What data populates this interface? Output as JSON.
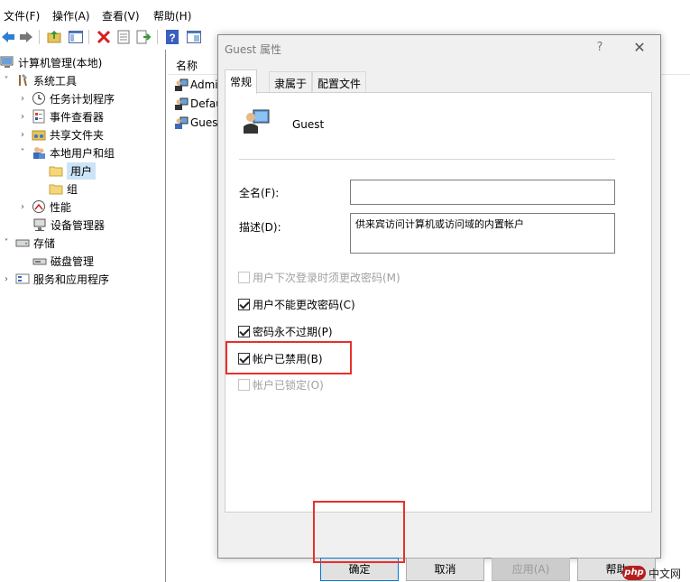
{
  "menu": {
    "items": [
      {
        "label": "文件(F)"
      },
      {
        "label": "操作(A)"
      },
      {
        "label": "查看(V)"
      },
      {
        "label": "帮助(H)"
      }
    ]
  },
  "toolbar": {
    "icons": [
      "back-arrow-icon",
      "forward-arrow-icon",
      "up-folder-icon",
      "show-hide-tree-icon",
      "delete-icon",
      "properties-icon",
      "export-icon",
      "help-icon",
      "console-icon"
    ]
  },
  "tree": {
    "items": [
      {
        "label": "计算机管理(本地)",
        "icon": "computer-management-icon"
      },
      {
        "label": "系统工具",
        "icon": "tools-icon"
      },
      {
        "label": "任务计划程序",
        "icon": "task-scheduler-icon"
      },
      {
        "label": "事件查看器",
        "icon": "event-viewer-icon"
      },
      {
        "label": "共享文件夹",
        "icon": "shared-folder-icon"
      },
      {
        "label": "本地用户和组",
        "icon": "local-users-groups-icon"
      },
      {
        "label": "用户",
        "icon": "folder-icon"
      },
      {
        "label": "组",
        "icon": "folder-icon"
      },
      {
        "label": "性能",
        "icon": "performance-icon"
      },
      {
        "label": "设备管理器",
        "icon": "device-manager-icon"
      },
      {
        "label": "存储",
        "icon": "storage-icon"
      },
      {
        "label": "磁盘管理",
        "icon": "disk-management-icon"
      },
      {
        "label": "服务和应用程序",
        "icon": "services-icon"
      }
    ]
  },
  "list": {
    "column_name": "名称",
    "items": [
      {
        "label": "Admi"
      },
      {
        "label": "Defau"
      },
      {
        "label": "Guest"
      }
    ]
  },
  "dialog": {
    "title": "Guest 属性",
    "help": "?",
    "close": "✕",
    "tabs": [
      {
        "label": "常规"
      },
      {
        "label": "隶属于"
      },
      {
        "label": "配置文件"
      }
    ],
    "user_name": "Guest",
    "fullname_label": "全名(F):",
    "fullname_value": "",
    "description_label": "描述(D):",
    "description_value": "供来宾访问计算机或访问域的内置帐户",
    "checkboxes": [
      {
        "label": "用户下次登录时须更改密码(M)",
        "checked": false,
        "enabled": false
      },
      {
        "label": "用户不能更改密码(C)",
        "checked": true,
        "enabled": true
      },
      {
        "label": "密码永不过期(P)",
        "checked": true,
        "enabled": true
      },
      {
        "label": "帐户已禁用(B)",
        "checked": true,
        "enabled": true
      },
      {
        "label": "帐户已锁定(O)",
        "checked": false,
        "enabled": false
      }
    ],
    "buttons": {
      "ok": "确定",
      "cancel": "取消",
      "apply": "应用(A)",
      "help": "帮助"
    }
  },
  "highlight_color": "#e8302c",
  "watermark": {
    "logo_text": "php",
    "text": "中文网"
  }
}
